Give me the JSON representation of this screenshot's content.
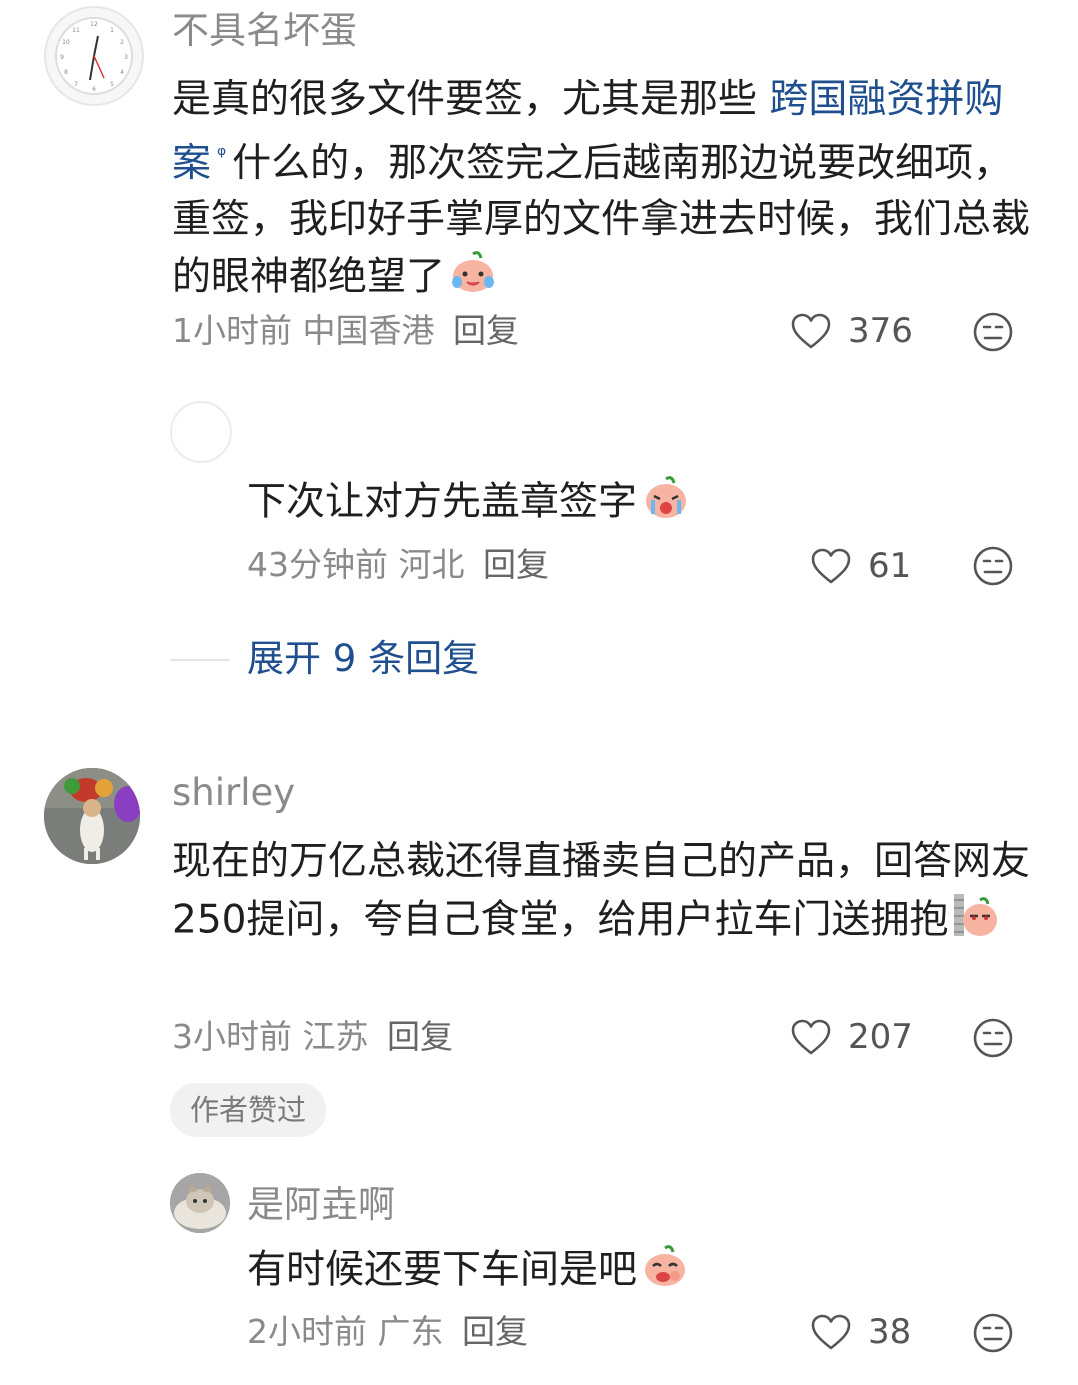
{
  "comments": [
    {
      "username": "不具名坏蛋",
      "text_before_link": "是真的很多文件要签，尤其是那些 ",
      "link_text": "跨国融资拼购案",
      "text_after_link": "什么的，那次签完之后越南那边说要改细项，重签，我印好手掌厚的文件拿进去时候，我们总裁的眼神都绝望了",
      "time": "1小时前",
      "location": "中国香港",
      "reply_label": "回复",
      "likes": "376",
      "emoji": "crying-face-sticker"
    },
    {
      "username": "shirley",
      "text": "现在的万亿总裁还得直播卖自己的产品，回答网友250提问，夸自己食堂，给用户拉车门送拥抱",
      "time": "3小时前",
      "location": "江苏",
      "reply_label": "回复",
      "likes": "207",
      "badge": "作者赞过",
      "emoji": "peeking-sticker"
    }
  ],
  "replies": [
    {
      "text": "下次让对方先盖章签字",
      "time": "43分钟前",
      "location": "河北",
      "reply_label": "回复",
      "likes": "61",
      "emoji": "crying-sticker"
    },
    {
      "username": "是阿垚啊",
      "text": "有时候还要下车间是吧",
      "time": "2小时前",
      "location": "广东",
      "reply_label": "回复",
      "likes": "38",
      "emoji": "laughing-sticker"
    }
  ],
  "expand_replies_label": "展开 9 条回复",
  "colors": {
    "link": "#1f4f8f",
    "meta": "#8a8a8a",
    "badge_bg": "#f1f1f1"
  }
}
